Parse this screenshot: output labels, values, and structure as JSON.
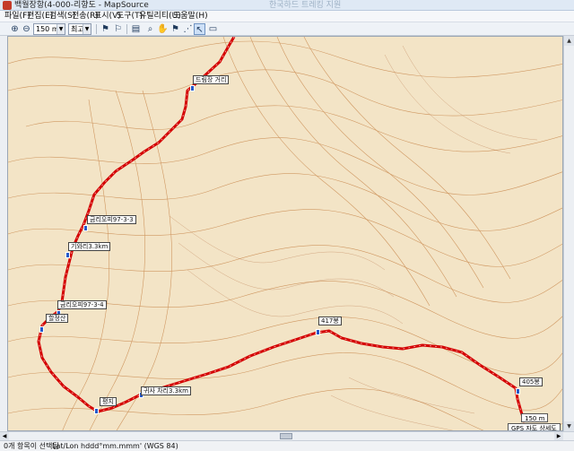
{
  "window": {
    "title": "백월장항(4-000-리향도 - MapSource",
    "ghost_title": "한국하드 트레킹 지원"
  },
  "menu": [
    "파일(F)",
    "편집(E)",
    "검색(S)",
    "전송(R)",
    "표시(V)",
    "도구(T)",
    "유틸리티(U)",
    "도움말(H)"
  ],
  "toolbar": {
    "zoom_in_icon": "zoom-in-icon",
    "zoom_out_icon": "zoom-out-icon",
    "scale_value": "150 m",
    "detail_value": "최고",
    "tools": [
      "route-tool-icon",
      "waypoint-tool-icon",
      "note-tool-icon",
      "zoom-tool-icon",
      "pan-tool-icon",
      "flag-tool-icon",
      "track-tool-icon",
      "select-tool-icon",
      "measure-tool-icon"
    ]
  },
  "map": {
    "waypoints": [
      {
        "label": "드림장 거리"
      },
      {
        "label": "금리오피97-3-3"
      },
      {
        "label": "기와리3.3km"
      },
      {
        "label": "금리오피97-3-4"
      },
      {
        "label": "할정산"
      },
      {
        "label": "417봉"
      },
      {
        "label": "405봉"
      },
      {
        "label": "평지"
      },
      {
        "label": "귀사 차리3.3km"
      }
    ],
    "scale_label": "150 m",
    "source_label": "GPS 자도 상세도",
    "colors": {
      "terrain": "#f3e4c6",
      "contour": "#c98a50",
      "track": "#d40000",
      "waypoint": "#2659c9"
    }
  },
  "statusbar": {
    "selection": "0개 항목이 선택됨",
    "coords": "Lat/Lon hddd°mm.mmm' (WGS 84)"
  }
}
